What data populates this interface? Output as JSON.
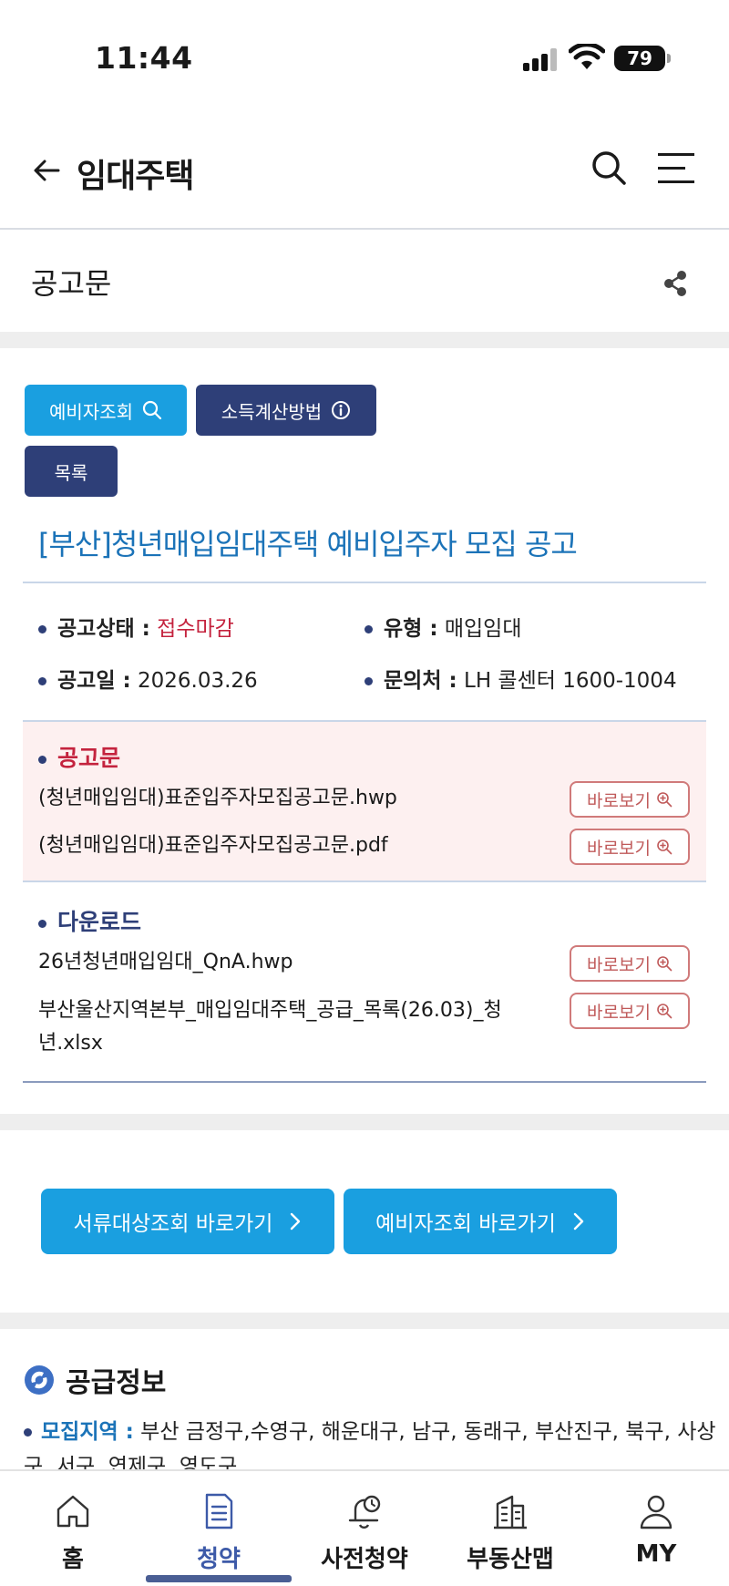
{
  "status": {
    "time": "11:44",
    "battery": "79"
  },
  "header": {
    "title": "임대주택"
  },
  "section": {
    "title": "공고문"
  },
  "chips": {
    "preliminary_lookup": "예비자조회",
    "income_method": "소득계산방법",
    "list": "목록"
  },
  "notice": {
    "title": "[부산]청년매입임대주택 예비입주자 모집 공고",
    "status_label": "공고상태 :",
    "status_value": "접수마감",
    "type_label": "유형 :",
    "type_value": "매입임대",
    "date_label": "공고일 :",
    "date_value": "2026.03.26",
    "contact_label": "문의처 :",
    "contact_value": "LH 콜센터 1600-1004"
  },
  "notice_files": {
    "heading": "공고문",
    "items": [
      {
        "name": "(청년매입임대)표준입주자모집공고문.hwp",
        "button": "바로보기"
      },
      {
        "name": "(청년매입임대)표준입주자모집공고문.pdf",
        "button": "바로보기"
      }
    ]
  },
  "download_files": {
    "heading": "다운로드",
    "items": [
      {
        "name": "26년청년매입임대_QnA.hwp",
        "button": "바로보기"
      },
      {
        "name": "부산울산지역본부_매입임대주택_공급_목록(26.03)_청년.xlsx",
        "button": "바로보기"
      }
    ]
  },
  "actions": {
    "documents_lookup": "서류대상조회 바로가기",
    "preliminary_lookup": "예비자조회 바로가기"
  },
  "supply": {
    "title": "공급정보",
    "region_label": "모집지역 :",
    "region_value": "부산 금정구,수영구, 해운대구, 남구, 동래구, 부산진구, 북구, 사상구, 서구, 연제구, 영도구"
  },
  "nav": {
    "items": [
      {
        "label": "홈",
        "icon": "home-icon"
      },
      {
        "label": "청약",
        "icon": "document-icon"
      },
      {
        "label": "사전청약",
        "icon": "bell-clock-icon"
      },
      {
        "label": "부동산맵",
        "icon": "building-map-icon"
      },
      {
        "label": "MY",
        "icon": "user-icon"
      }
    ],
    "active_index": 1
  },
  "colors": {
    "primary_blue": "#1a9fe0",
    "navy": "#2e3f78",
    "red": "#c4233e",
    "link_blue": "#1b73b8"
  }
}
